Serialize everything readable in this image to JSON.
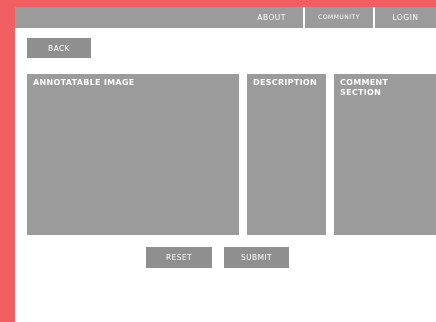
{
  "nav": {
    "items": [
      {
        "label": "ABOUT"
      },
      {
        "label": "COMMUNITY"
      },
      {
        "label": "LOGIN"
      }
    ]
  },
  "back_button": {
    "label": "BACK"
  },
  "panels": {
    "image": {
      "label": "ANNOTATABLE IMAGE"
    },
    "description": {
      "label": "DESCRIPTION"
    },
    "comments": {
      "label": "COMMENT SECTION"
    }
  },
  "actions": {
    "reset_label": "RESET",
    "submit_label": "SUBMIT"
  },
  "colors": {
    "frame_accent": "#f25f63",
    "panel_gray": "#9b9b9b",
    "button_gray": "#8f8f8f"
  }
}
